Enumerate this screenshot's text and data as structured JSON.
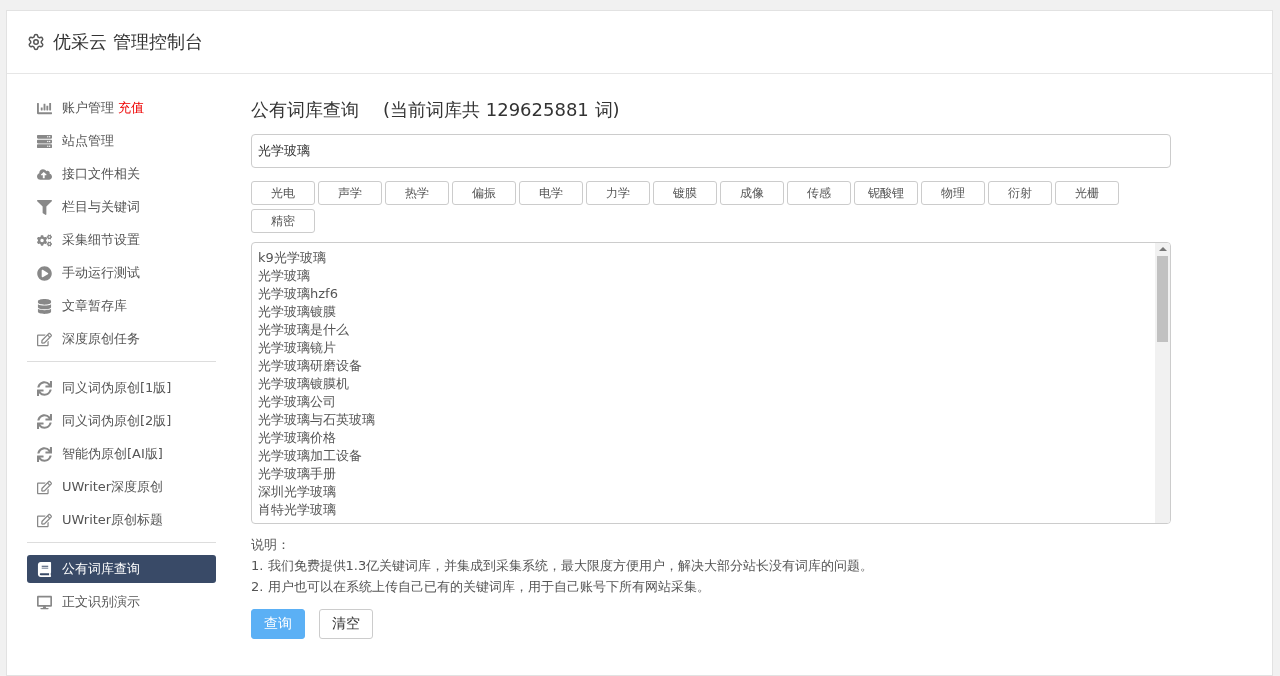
{
  "header": {
    "title": "优采云 管理控制台"
  },
  "sidebar": {
    "groups": [
      {
        "items": [
          {
            "kind": "chart",
            "label": "账户管理",
            "badge": "充值",
            "selected": false
          },
          {
            "kind": "server",
            "label": "站点管理",
            "selected": false
          },
          {
            "kind": "upload",
            "label": "接口文件相关",
            "selected": false
          },
          {
            "kind": "filter",
            "label": "栏目与关键词",
            "selected": false
          },
          {
            "kind": "gears",
            "label": "采集细节设置",
            "selected": false
          },
          {
            "kind": "play",
            "label": "手动运行测试",
            "selected": false
          },
          {
            "kind": "database",
            "label": "文章暂存库",
            "selected": false
          },
          {
            "kind": "edit",
            "label": "深度原创任务",
            "selected": false
          }
        ]
      },
      {
        "items": [
          {
            "kind": "sync",
            "label": "同义词伪原创[1版]",
            "selected": false
          },
          {
            "kind": "sync",
            "label": "同义词伪原创[2版]",
            "selected": false
          },
          {
            "kind": "sync",
            "label": "智能伪原创[AI版]",
            "selected": false
          },
          {
            "kind": "edit",
            "label": "UWriter深度原创",
            "selected": false
          },
          {
            "kind": "edit",
            "label": "UWriter原创标题",
            "selected": false
          }
        ]
      },
      {
        "items": [
          {
            "kind": "book",
            "label": "公有词库查询",
            "selected": true
          },
          {
            "kind": "monitor",
            "label": "正文识别演示",
            "selected": false
          }
        ]
      }
    ]
  },
  "main": {
    "title": "公有词库查询",
    "count_note": "(当前词库共 129625881 词)",
    "search": {
      "value": "光学玻璃"
    },
    "tags": [
      "光电",
      "声学",
      "热学",
      "偏振",
      "电学",
      "力学",
      "镀膜",
      "成像",
      "传感",
      "铌酸锂",
      "物理",
      "衍射",
      "光栅",
      "精密"
    ],
    "results": [
      "k9光学玻璃",
      "光学玻璃",
      "光学玻璃hzf6",
      "光学玻璃镀膜",
      "光学玻璃是什么",
      "光学玻璃镜片",
      "光学玻璃研磨设备",
      "光学玻璃镀膜机",
      "光学玻璃公司",
      "光学玻璃与石英玻璃",
      "光学玻璃价格",
      "光学玻璃加工设备",
      "光学玻璃手册",
      "深圳光学玻璃",
      "肖特光学玻璃"
    ],
    "notes": {
      "heading": "说明：",
      "lines": [
        "1. 我们免费提供1.3亿关键词库，并集成到采集系统，最大限度方便用户，解决大部分站长没有词库的问题。",
        "2. 用户也可以在系统上传自己已有的关键词库，用于自己账号下所有网站采集。"
      ]
    },
    "buttons": [
      {
        "kind": "primary",
        "label": "查询"
      },
      {
        "kind": "default",
        "label": "清空"
      }
    ]
  }
}
